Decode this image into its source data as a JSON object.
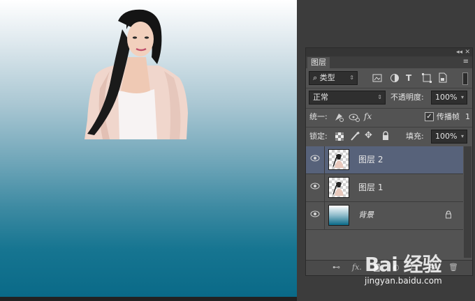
{
  "panel": {
    "collapse": "◂◂",
    "close": "✕",
    "tab_label": "图层",
    "menu_icon": "≡",
    "filter": {
      "search_icon": "⌕",
      "kind": "类型",
      "arrow": "⇕"
    },
    "filter_icons": [
      "image-filter-icon",
      "adjustment-filter-icon",
      "type-filter-icon",
      "shape-filter-icon",
      "smart-object-filter-icon"
    ],
    "blend_mode": "正常",
    "blend_arrow": "⇕",
    "opacity_label": "不透明度:",
    "opacity_value": "100%",
    "opacity_arrow": "▾",
    "unify_label": "统一:",
    "propagate_label": "传播帧",
    "propagate_value": "1",
    "propagate_checked": true,
    "lock_label": "锁定:",
    "fill_label": "填充:",
    "fill_value": "100%",
    "fill_arrow": "▾",
    "layers": [
      {
        "name": "图层 2",
        "selected": true,
        "thumb": "transparent-checker",
        "visible": true
      },
      {
        "name": "图层 1",
        "selected": false,
        "thumb": "transparent-checker",
        "visible": true
      },
      {
        "name": "背景",
        "selected": false,
        "thumb": "gradient",
        "visible": true,
        "locked": true
      }
    ],
    "footer_icons": [
      "link-layers-icon",
      "fx-icon",
      "mask-icon",
      "adjustment-icon",
      "group-icon",
      "new-layer-icon",
      "delete-icon"
    ]
  },
  "watermark": {
    "logo_text": "Bai 经验",
    "url": "jingyan.baidu.com"
  }
}
